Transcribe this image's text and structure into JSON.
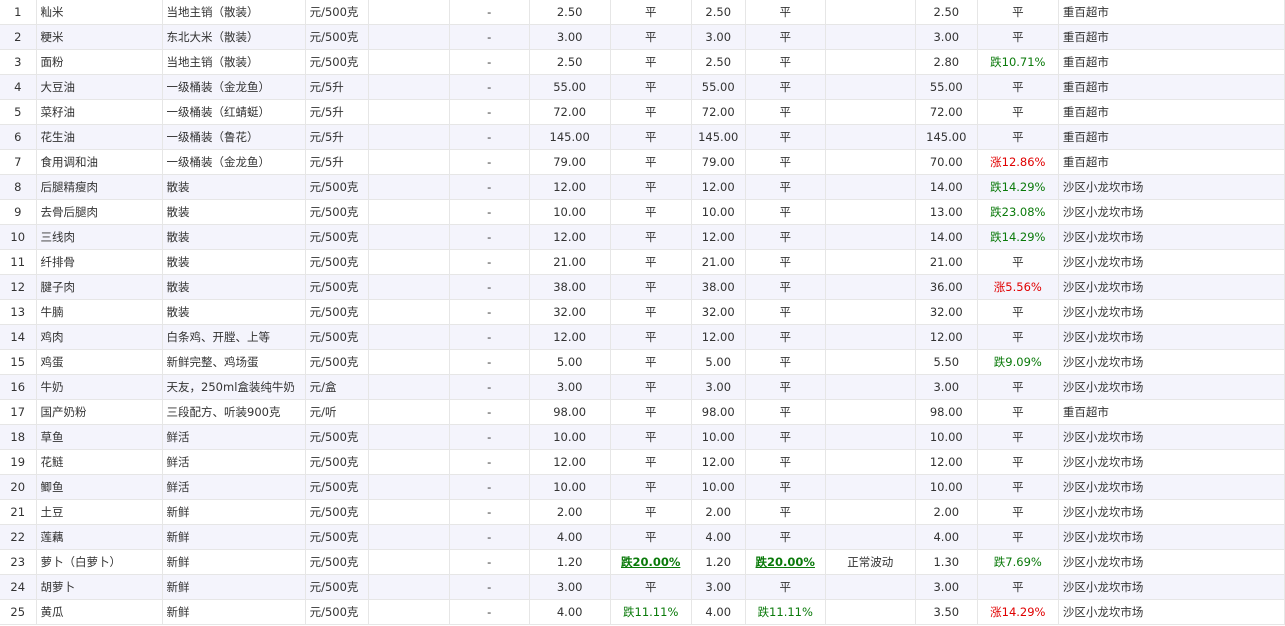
{
  "table": {
    "rows": [
      {
        "no": "1",
        "name": "籼米",
        "spec": "当地主销（散装）",
        "unit": "元/500克",
        "prev": "",
        "dash": "-",
        "p1": "2.50",
        "c1": "平",
        "p2": "2.50",
        "c2": "平",
        "note": "",
        "p3": "2.50",
        "c3": "平",
        "market": "重百超市"
      },
      {
        "no": "2",
        "name": "粳米",
        "spec": "东北大米（散装）",
        "unit": "元/500克",
        "prev": "",
        "dash": "-",
        "p1": "3.00",
        "c1": "平",
        "p2": "3.00",
        "c2": "平",
        "note": "",
        "p3": "3.00",
        "c3": "平",
        "market": "重百超市"
      },
      {
        "no": "3",
        "name": "面粉",
        "spec": "当地主销（散装）",
        "unit": "元/500克",
        "prev": "",
        "dash": "-",
        "p1": "2.50",
        "c1": "平",
        "p2": "2.50",
        "c2": "平",
        "note": "",
        "p3": "2.80",
        "c3": "跌10.71%",
        "market": "重百超市"
      },
      {
        "no": "4",
        "name": "大豆油",
        "spec": "一级桶装（金龙鱼）",
        "unit": "元/5升",
        "prev": "",
        "dash": "-",
        "p1": "55.00",
        "c1": "平",
        "p2": "55.00",
        "c2": "平",
        "note": "",
        "p3": "55.00",
        "c3": "平",
        "market": "重百超市"
      },
      {
        "no": "5",
        "name": "菜籽油",
        "spec": "一级桶装（红蜻蜓）",
        "unit": "元/5升",
        "prev": "",
        "dash": "-",
        "p1": "72.00",
        "c1": "平",
        "p2": "72.00",
        "c2": "平",
        "note": "",
        "p3": "72.00",
        "c3": "平",
        "market": "重百超市"
      },
      {
        "no": "6",
        "name": "花生油",
        "spec": "一级桶装（鲁花）",
        "unit": "元/5升",
        "prev": "",
        "dash": "-",
        "p1": "145.00",
        "c1": "平",
        "p2": "145.00",
        "c2": "平",
        "note": "",
        "p3": "145.00",
        "c3": "平",
        "market": "重百超市"
      },
      {
        "no": "7",
        "name": "食用调和油",
        "spec": "一级桶装（金龙鱼）",
        "unit": "元/5升",
        "prev": "",
        "dash": "-",
        "p1": "79.00",
        "c1": "平",
        "p2": "79.00",
        "c2": "平",
        "note": "",
        "p3": "70.00",
        "c3": "涨12.86%",
        "market": "重百超市"
      },
      {
        "no": "8",
        "name": "后腿精瘦肉",
        "spec": "散装",
        "unit": "元/500克",
        "prev": "",
        "dash": "-",
        "p1": "12.00",
        "c1": "平",
        "p2": "12.00",
        "c2": "平",
        "note": "",
        "p3": "14.00",
        "c3": "跌14.29%",
        "market": "沙区小龙坎市场"
      },
      {
        "no": "9",
        "name": "去骨后腿肉",
        "spec": "散装",
        "unit": "元/500克",
        "prev": "",
        "dash": "-",
        "p1": "10.00",
        "c1": "平",
        "p2": "10.00",
        "c2": "平",
        "note": "",
        "p3": "13.00",
        "c3": "跌23.08%",
        "market": "沙区小龙坎市场"
      },
      {
        "no": "10",
        "name": "三线肉",
        "spec": "散装",
        "unit": "元/500克",
        "prev": "",
        "dash": "-",
        "p1": "12.00",
        "c1": "平",
        "p2": "12.00",
        "c2": "平",
        "note": "",
        "p3": "14.00",
        "c3": "跌14.29%",
        "market": "沙区小龙坎市场"
      },
      {
        "no": "11",
        "name": "纤排骨",
        "spec": "散装",
        "unit": "元/500克",
        "prev": "",
        "dash": "-",
        "p1": "21.00",
        "c1": "平",
        "p2": "21.00",
        "c2": "平",
        "note": "",
        "p3": "21.00",
        "c3": "平",
        "market": "沙区小龙坎市场"
      },
      {
        "no": "12",
        "name": "腱子肉",
        "spec": "散装",
        "unit": "元/500克",
        "prev": "",
        "dash": "-",
        "p1": "38.00",
        "c1": "平",
        "p2": "38.00",
        "c2": "平",
        "note": "",
        "p3": "36.00",
        "c3": "涨5.56%",
        "market": "沙区小龙坎市场"
      },
      {
        "no": "13",
        "name": "牛腩",
        "spec": "散装",
        "unit": "元/500克",
        "prev": "",
        "dash": "-",
        "p1": "32.00",
        "c1": "平",
        "p2": "32.00",
        "c2": "平",
        "note": "",
        "p3": "32.00",
        "c3": "平",
        "market": "沙区小龙坎市场"
      },
      {
        "no": "14",
        "name": "鸡肉",
        "spec": "白条鸡、开膛、上等",
        "unit": "元/500克",
        "prev": "",
        "dash": "-",
        "p1": "12.00",
        "c1": "平",
        "p2": "12.00",
        "c2": "平",
        "note": "",
        "p3": "12.00",
        "c3": "平",
        "market": "沙区小龙坎市场"
      },
      {
        "no": "15",
        "name": "鸡蛋",
        "spec": "新鲜完整、鸡场蛋",
        "unit": "元/500克",
        "prev": "",
        "dash": "-",
        "p1": "5.00",
        "c1": "平",
        "p2": "5.00",
        "c2": "平",
        "note": "",
        "p3": "5.50",
        "c3": "跌9.09%",
        "market": "沙区小龙坎市场"
      },
      {
        "no": "16",
        "name": "牛奶",
        "spec": "天友，250ml盒装纯牛奶",
        "unit": "元/盒",
        "prev": "",
        "dash": "-",
        "p1": "3.00",
        "c1": "平",
        "p2": "3.00",
        "c2": "平",
        "note": "",
        "p3": "3.00",
        "c3": "平",
        "market": "沙区小龙坎市场"
      },
      {
        "no": "17",
        "name": "国产奶粉",
        "spec": "三段配方、听装900克",
        "unit": "元/听",
        "prev": "",
        "dash": "-",
        "p1": "98.00",
        "c1": "平",
        "p2": "98.00",
        "c2": "平",
        "note": "",
        "p3": "98.00",
        "c3": "平",
        "market": "重百超市"
      },
      {
        "no": "18",
        "name": "草鱼",
        "spec": "鲜活",
        "unit": "元/500克",
        "prev": "",
        "dash": "-",
        "p1": "10.00",
        "c1": "平",
        "p2": "10.00",
        "c2": "平",
        "note": "",
        "p3": "10.00",
        "c3": "平",
        "market": "沙区小龙坎市场"
      },
      {
        "no": "19",
        "name": "花鲢",
        "spec": "鲜活",
        "unit": "元/500克",
        "prev": "",
        "dash": "-",
        "p1": "12.00",
        "c1": "平",
        "p2": "12.00",
        "c2": "平",
        "note": "",
        "p3": "12.00",
        "c3": "平",
        "market": "沙区小龙坎市场"
      },
      {
        "no": "20",
        "name": "鲫鱼",
        "spec": "鲜活",
        "unit": "元/500克",
        "prev": "",
        "dash": "-",
        "p1": "10.00",
        "c1": "平",
        "p2": "10.00",
        "c2": "平",
        "note": "",
        "p3": "10.00",
        "c3": "平",
        "market": "沙区小龙坎市场"
      },
      {
        "no": "21",
        "name": "土豆",
        "spec": "新鲜",
        "unit": "元/500克",
        "prev": "",
        "dash": "-",
        "p1": "2.00",
        "c1": "平",
        "p2": "2.00",
        "c2": "平",
        "note": "",
        "p3": "2.00",
        "c3": "平",
        "market": "沙区小龙坎市场"
      },
      {
        "no": "22",
        "name": "莲藕",
        "spec": "新鲜",
        "unit": "元/500克",
        "prev": "",
        "dash": "-",
        "p1": "4.00",
        "c1": "平",
        "p2": "4.00",
        "c2": "平",
        "note": "",
        "p3": "4.00",
        "c3": "平",
        "market": "沙区小龙坎市场"
      },
      {
        "no": "23",
        "name": "萝卜（白萝卜）",
        "spec": "新鲜",
        "unit": "元/500克",
        "prev": "",
        "dash": "-",
        "p1": "1.20",
        "c1": "跌20.00%",
        "p2": "1.20",
        "c2": "跌20.00%",
        "note": "正常波动",
        "p3": "1.30",
        "c3": "跌7.69%",
        "market": "沙区小龙坎市场"
      },
      {
        "no": "24",
        "name": "胡萝卜",
        "spec": "新鲜",
        "unit": "元/500克",
        "prev": "",
        "dash": "-",
        "p1": "3.00",
        "c1": "平",
        "p2": "3.00",
        "c2": "平",
        "note": "",
        "p3": "3.00",
        "c3": "平",
        "market": "沙区小龙坎市场"
      },
      {
        "no": "25",
        "name": "黄瓜",
        "spec": "新鲜",
        "unit": "元/500克",
        "prev": "",
        "dash": "-",
        "p1": "4.00",
        "c1": "跌11.11%",
        "p2": "4.00",
        "c2": "跌11.11%",
        "note": "",
        "p3": "3.50",
        "c3": "涨14.29%",
        "market": "沙区小龙坎市场"
      }
    ],
    "colors": {
      "down": "#0a7a0a",
      "up": "#e00000",
      "stripe": "#f4f4fc",
      "border": "#e6e6e6"
    }
  }
}
